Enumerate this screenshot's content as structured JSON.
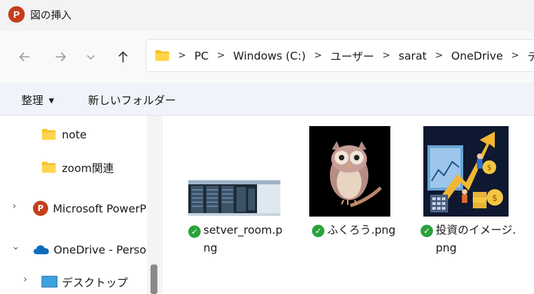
{
  "window": {
    "app_icon_letter": "P",
    "title": "図の挿入"
  },
  "address_bar": {
    "breadcrumbs": [
      "PC",
      "Windows (C:)",
      "ユーザー",
      "sarat",
      "OneDrive",
      "デスクトップ"
    ],
    "separator": ">"
  },
  "toolbar": {
    "organize_label": "整理",
    "new_folder_label": "新しいフォルダー"
  },
  "sidebar": {
    "items": [
      {
        "label": "note"
      },
      {
        "label": "zoom関連"
      },
      {
        "label": "Microsoft PowerPoint"
      },
      {
        "label": "OneDrive - Personal"
      },
      {
        "label": "デスクトップ"
      }
    ],
    "chevron_right": "›",
    "chevron_down": "⌄"
  },
  "files": [
    {
      "name_line1": "setver_room.p",
      "name_line2": "ng",
      "status_icon": "✓"
    },
    {
      "name_line1": "ふくろう.png",
      "name_line2": "",
      "status_icon": "✓"
    },
    {
      "name_line1": "投資のイメージ.",
      "name_line2": "png",
      "status_icon": "✓"
    }
  ],
  "colors": {
    "accent_folder": "#f4c430",
    "sync_check": "#2aa33a",
    "onedrive": "#0f6cbd",
    "powerpoint": "#c43e1c"
  }
}
